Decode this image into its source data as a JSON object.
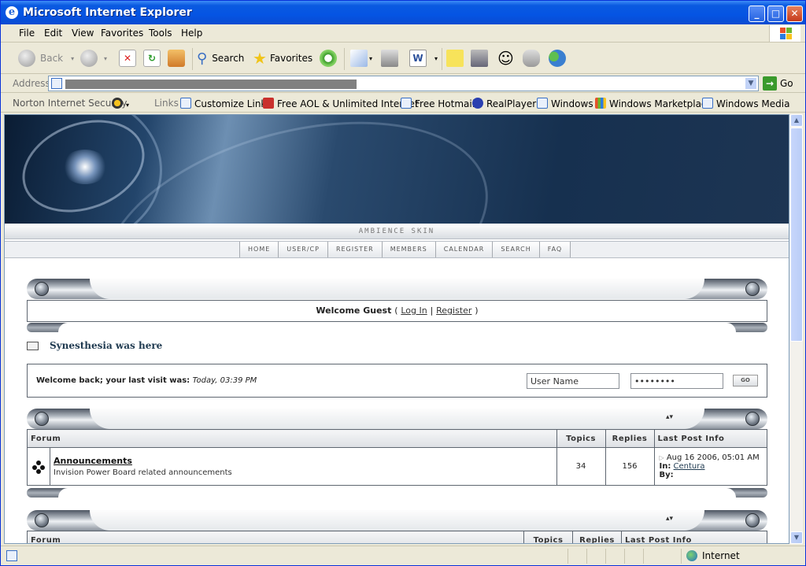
{
  "window": {
    "title": "Microsoft Internet Explorer"
  },
  "menu": [
    "File",
    "Edit",
    "View",
    "Favorites",
    "Tools",
    "Help"
  ],
  "toolbar": {
    "back": "Back",
    "search": "Search",
    "favorites": "Favorites"
  },
  "address": {
    "label": "Address",
    "go": "Go"
  },
  "links": {
    "norton": "Norton Internet Security",
    "label": "Links",
    "items": [
      "Customize Links",
      "Free AOL & Unlimited Internet",
      "Free Hotmail",
      "RealPlayer",
      "Windows",
      "Windows Marketplace",
      "Windows Media"
    ]
  },
  "page": {
    "skin_label": "AMBIENCE SKIN",
    "nav": [
      "HOME",
      "USER/CP",
      "REGISTER",
      "MEMBERS",
      "CALENDAR",
      "SEARCH",
      "FAQ"
    ],
    "welcome": {
      "prefix": "Welcome Guest",
      "open": "(",
      "login": "Log In",
      "sep": "|",
      "register": "Register",
      "close": ")"
    },
    "site_name": "Synesthesia was here",
    "last_visit": {
      "label": "Welcome back; your last visit was:",
      "value": "Today, 03:39 PM"
    },
    "login_form": {
      "username": "User Name",
      "password": "••••••••",
      "go": "GO"
    },
    "table_headers": [
      "Forum",
      "Topics",
      "Replies",
      "Last Post Info"
    ],
    "forums": [
      {
        "name": "Announcements",
        "description": "Invision Power Board related announcements",
        "topics": "34",
        "replies": "156",
        "last_date": "Aug 16 2006, 05:01 AM",
        "in_label": "In:",
        "in_topic": "Centura",
        "by_label": "By:"
      }
    ],
    "minimize_glyph": "▴▾"
  },
  "status": {
    "zone": "Internet"
  }
}
